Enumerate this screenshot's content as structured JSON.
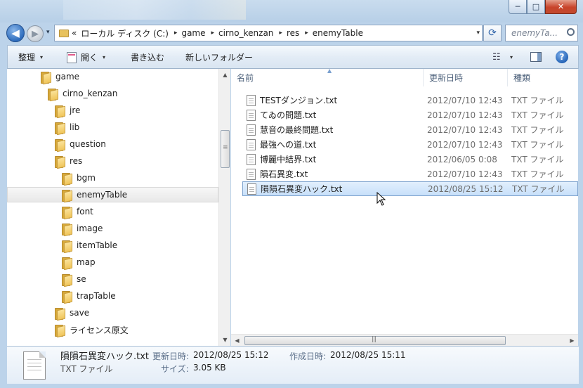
{
  "window": {
    "controls": {
      "minimize": "─",
      "maximize": "□",
      "close": "✕"
    }
  },
  "nav": {
    "back_glyph": "◀",
    "forward_glyph": "▶",
    "history_glyph": "▾",
    "overflow": "«",
    "breadcrumbs": [
      "ローカル ディスク (C:)",
      "game",
      "cirno_kenzan",
      "res",
      "enemyTable"
    ],
    "separator_glyph": "▸",
    "dropdown_glyph": "▾",
    "refresh_glyph": "⟳",
    "search_placeholder": "enemyTa..."
  },
  "toolbar": {
    "organize": "整理",
    "open": "開く",
    "burn": "書き込む",
    "new_folder": "新しいフォルダー",
    "caret": "▾",
    "view_glyph": "☷",
    "help_glyph": "?"
  },
  "tree": [
    {
      "label": "game",
      "depth": 0,
      "selected": false
    },
    {
      "label": "cirno_kenzan",
      "depth": 1,
      "selected": false
    },
    {
      "label": "jre",
      "depth": 2,
      "selected": false
    },
    {
      "label": "lib",
      "depth": 2,
      "selected": false
    },
    {
      "label": "question",
      "depth": 2,
      "selected": false
    },
    {
      "label": "res",
      "depth": 2,
      "selected": false
    },
    {
      "label": "bgm",
      "depth": 3,
      "selected": false
    },
    {
      "label": "enemyTable",
      "depth": 3,
      "selected": true
    },
    {
      "label": "font",
      "depth": 3,
      "selected": false
    },
    {
      "label": "image",
      "depth": 3,
      "selected": false
    },
    {
      "label": "itemTable",
      "depth": 3,
      "selected": false
    },
    {
      "label": "map",
      "depth": 3,
      "selected": false
    },
    {
      "label": "se",
      "depth": 3,
      "selected": false
    },
    {
      "label": "trapTable",
      "depth": 3,
      "selected": false
    },
    {
      "label": "save",
      "depth": 2,
      "selected": false
    },
    {
      "label": "ライセンス原文",
      "depth": 2,
      "selected": false
    }
  ],
  "columns": {
    "name": "名前",
    "date": "更新日時",
    "type": "種類"
  },
  "files": [
    {
      "name": "TESTダンジョン.txt",
      "date": "2012/07/10 12:43",
      "type": "TXT ファイル",
      "selected": false
    },
    {
      "name": "てゐの問題.txt",
      "date": "2012/07/10 12:43",
      "type": "TXT ファイル",
      "selected": false
    },
    {
      "name": "慧音の最終問題.txt",
      "date": "2012/07/10 12:43",
      "type": "TXT ファイル",
      "selected": false
    },
    {
      "name": "最強への道.txt",
      "date": "2012/07/10 12:43",
      "type": "TXT ファイル",
      "selected": false
    },
    {
      "name": "博麗中結界.txt",
      "date": "2012/06/05 0:08",
      "type": "TXT ファイル",
      "selected": false
    },
    {
      "name": "隕石異変.txt",
      "date": "2012/07/10 12:43",
      "type": "TXT ファイル",
      "selected": false
    },
    {
      "name": "隕隕石異変ハック.txt",
      "date": "2012/08/25 15:12",
      "type": "TXT ファイル",
      "selected": true
    }
  ],
  "scroll": {
    "up": "▲",
    "down": "▼",
    "left": "◀",
    "right": "▶"
  },
  "details": {
    "name": "隕隕石異変ハック.txt",
    "type": "TXT ファイル",
    "modified_label": "更新日時:",
    "modified_value": "2012/08/25 15:12",
    "created_label": "作成日時:",
    "created_value": "2012/08/25 15:11",
    "size_label": "サイズ:",
    "size_value": "3.05 KB"
  }
}
